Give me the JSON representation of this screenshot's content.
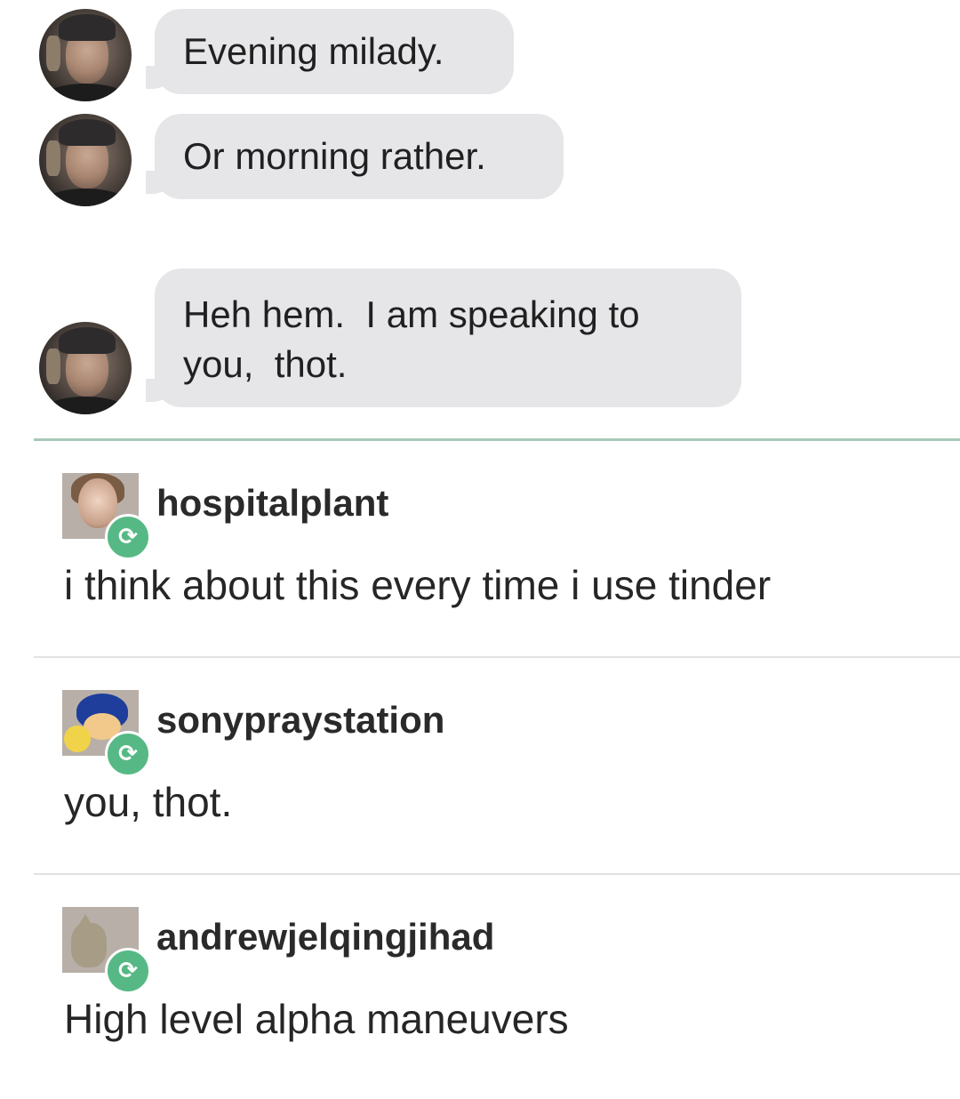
{
  "chat": {
    "messages": [
      {
        "text_lines": [
          "Evening milady."
        ]
      },
      {
        "text_lines": [
          "Or morning rather."
        ]
      },
      {
        "text_lines": [
          "Heh hem.  I am speaking to",
          "you,  thot."
        ]
      }
    ]
  },
  "reblogs": [
    {
      "username": "hospitalplant",
      "comment": "i think about this every time i use tinder",
      "reblog_icon": "reblog-icon"
    },
    {
      "username": "sonypraystation",
      "comment": "you, thot.",
      "reblog_icon": "reblog-icon"
    },
    {
      "username": "andrewjelqingjihad",
      "comment": "High level alpha maneuvers",
      "reblog_icon": "reblog-icon"
    }
  ],
  "colors": {
    "bubble": "#e6e6e9",
    "reblog_badge": "#56b985",
    "divider_green": "#a8c8b8",
    "divider_gray": "#e2e2e2"
  },
  "badge_glyph": "⟳"
}
